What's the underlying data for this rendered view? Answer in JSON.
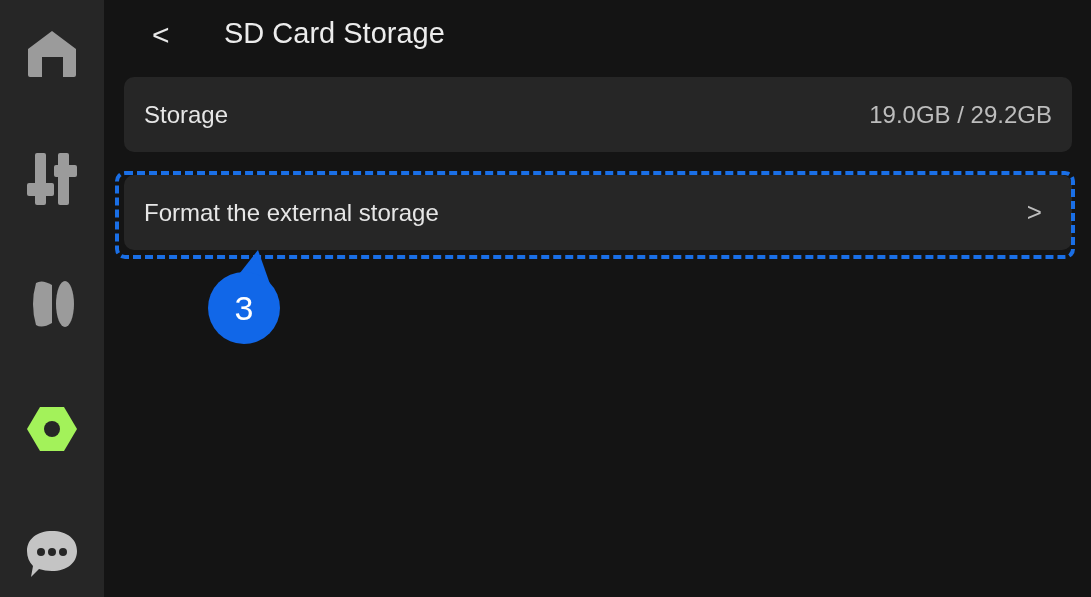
{
  "sidebar": {
    "items": [
      {
        "kind": "home",
        "selected": false
      },
      {
        "kind": "sliders",
        "selected": false
      },
      {
        "kind": "lens",
        "selected": false
      },
      {
        "kind": "settings",
        "selected": true
      },
      {
        "kind": "chat",
        "selected": false
      }
    ]
  },
  "header": {
    "back": "<",
    "title": "SD Card Storage"
  },
  "rows": [
    {
      "kind": "info",
      "label": "Storage",
      "value": "19.0GB / 29.2GB"
    },
    {
      "kind": "link",
      "label": "Format the external storage",
      "chevron": ">",
      "highlighted": true
    }
  ],
  "callout": {
    "label": "3"
  }
}
